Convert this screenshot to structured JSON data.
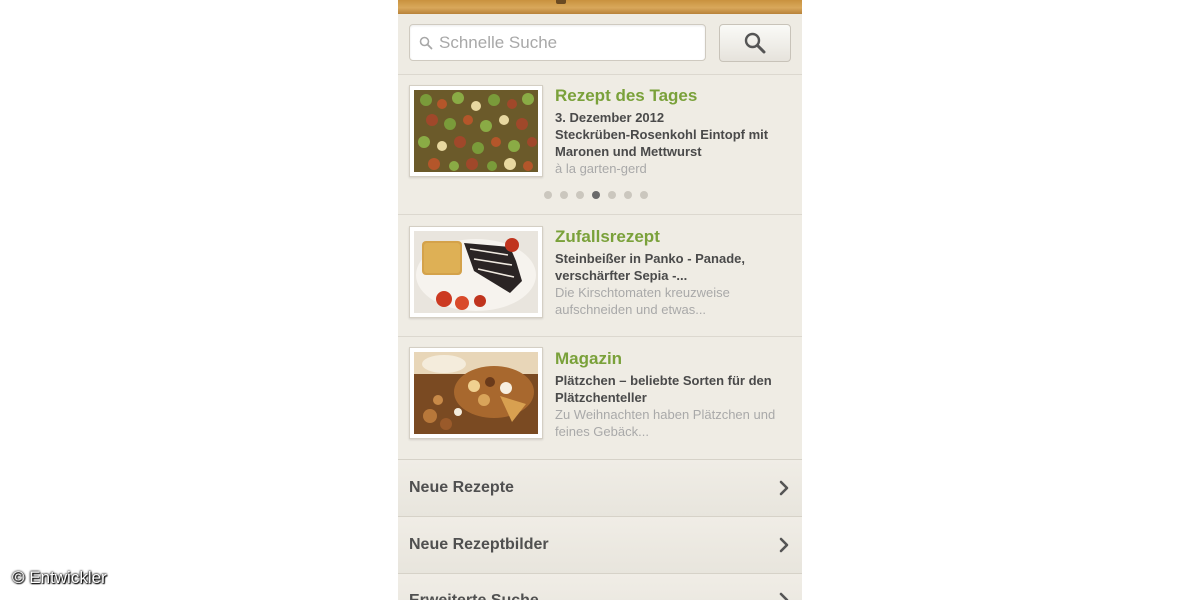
{
  "search": {
    "placeholder": "Schnelle Suche",
    "button_icon": "search-icon"
  },
  "cards": [
    {
      "title": "Rezept des Tages",
      "date": "3. Dezember 2012",
      "headline": "Steckrüben-Rosenkohl Eintopf mit Maronen und Mettwurst",
      "sub": "à la garten-gerd",
      "image": "stew-with-brussels-sprouts-photo"
    },
    {
      "title": "Zufallsrezept",
      "headline": "Steinbeißer in Panko - Panade, verschärfter Sepia -...",
      "sub": "Die Kirschtomaten kreuzweise aufschneiden und etwas...",
      "image": "fish-in-panko-with-tomatoes-photo"
    },
    {
      "title": "Magazin",
      "headline": "Plätzchen – beliebte Sorten für den Plätzchenteller",
      "sub": "Zu Weihnachten haben Plätzchen und feines Gebäck...",
      "image": "christmas-cookies-photo"
    }
  ],
  "carousel": {
    "total": 7,
    "active_index": 3
  },
  "menu": [
    {
      "label": "Neue Rezepte"
    },
    {
      "label": "Neue Rezeptbilder"
    },
    {
      "label": "Erweiterte Suche"
    }
  ],
  "watermark": "© Entwickler",
  "colors": {
    "title_green": "#7aa13a",
    "background": "#efece4",
    "wood": "#c9923e"
  }
}
